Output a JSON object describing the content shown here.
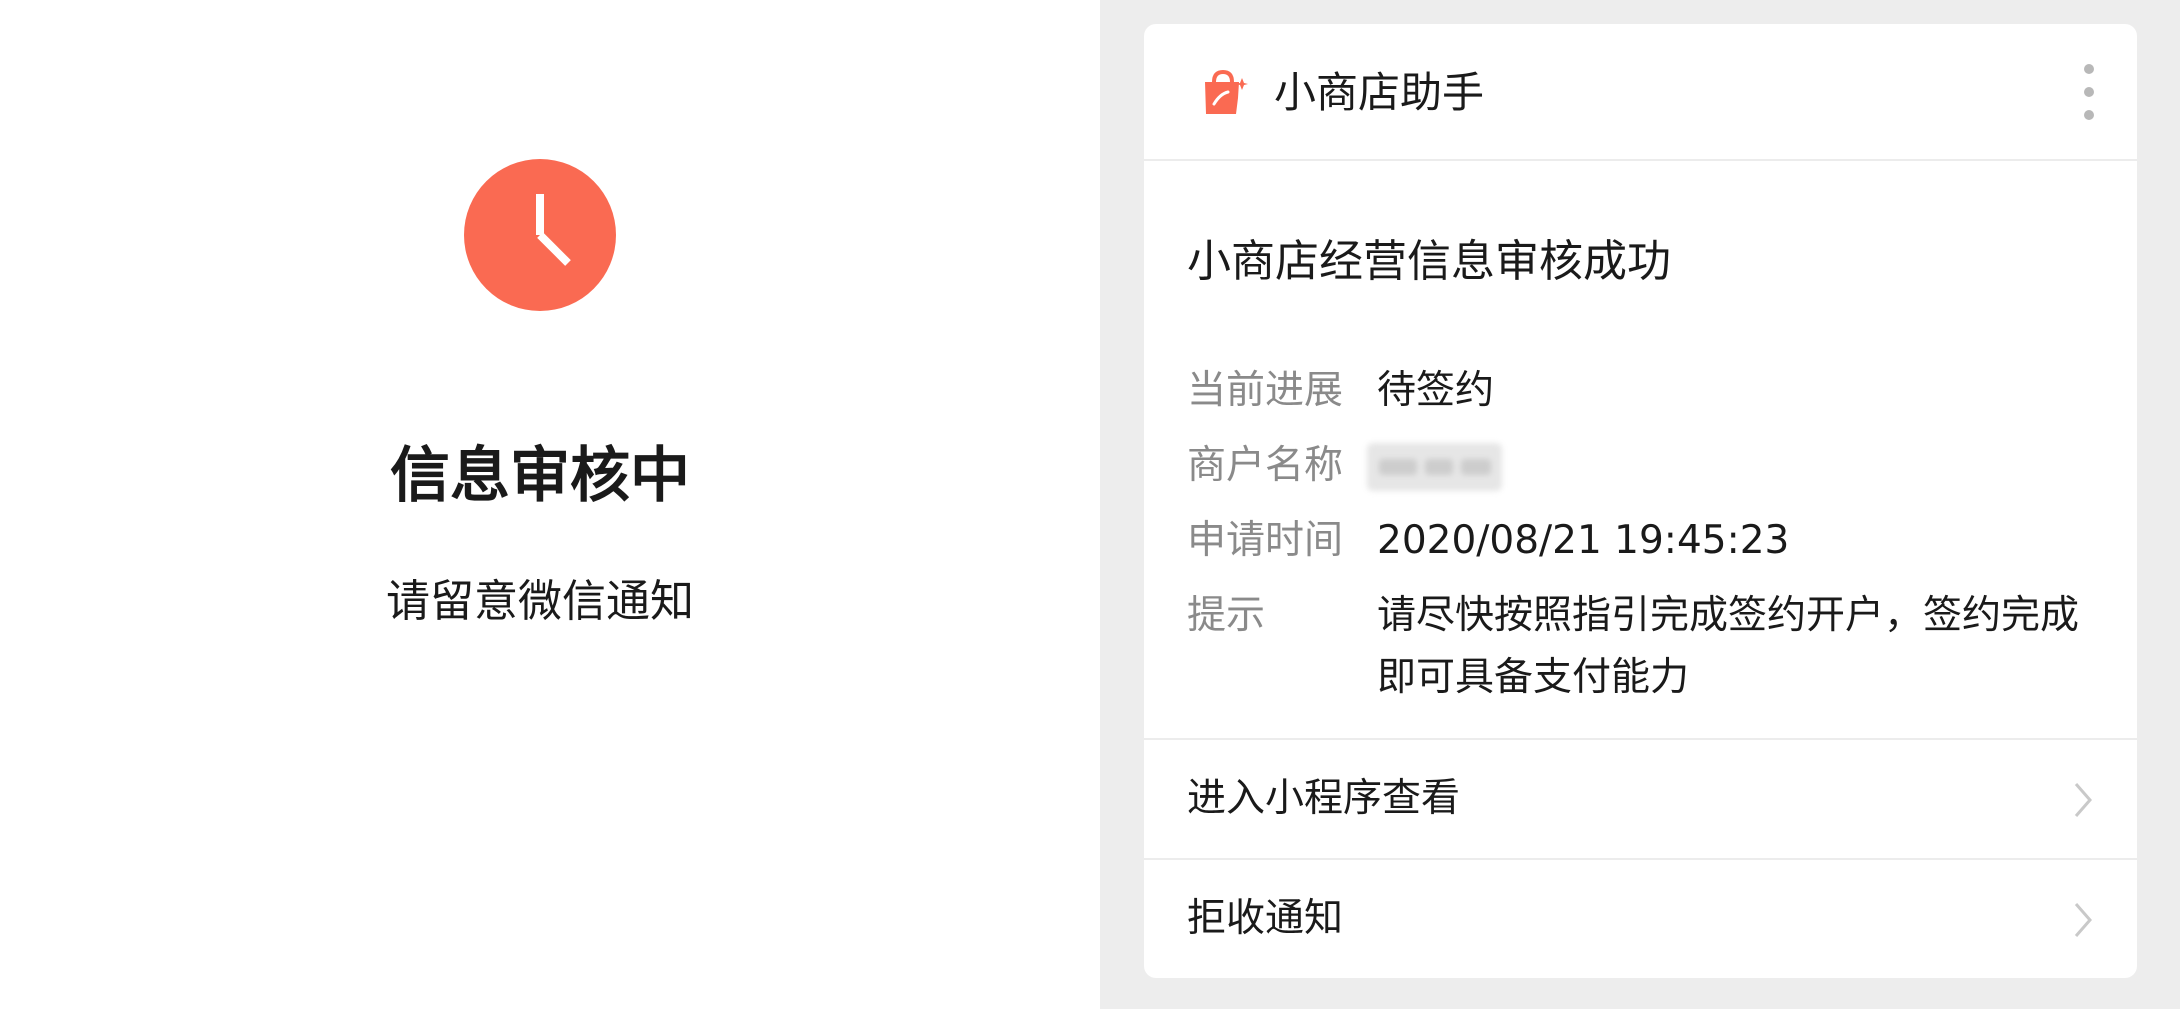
{
  "status_page": {
    "icon": "clock-icon",
    "title": "信息审核中",
    "subtitle": "请留意微信通知",
    "accent_color": "#fa6a52"
  },
  "notification": {
    "app_name": "小商店助手",
    "app_icon": "shopping-bag-icon",
    "more_icon": "more-vertical-icon",
    "title": "小商店经营信息审核成功",
    "fields": [
      {
        "label": "当前进展",
        "value": "待签约"
      },
      {
        "label": "商户名称",
        "value": ""
      },
      {
        "label": "申请时间",
        "value": "2020/08/21 19:45:23"
      },
      {
        "label": "提示",
        "value": "请尽快按照指引完成签约开户，签约完成即可具备支付能力"
      }
    ],
    "actions": [
      {
        "label": "进入小程序查看",
        "icon": "chevron-right-icon"
      },
      {
        "label": "拒收通知",
        "icon": "chevron-right-icon"
      }
    ]
  },
  "colors": {
    "brand": "#fa6a52",
    "panel_background": "#ededed",
    "label_gray": "#8a8a8a"
  }
}
